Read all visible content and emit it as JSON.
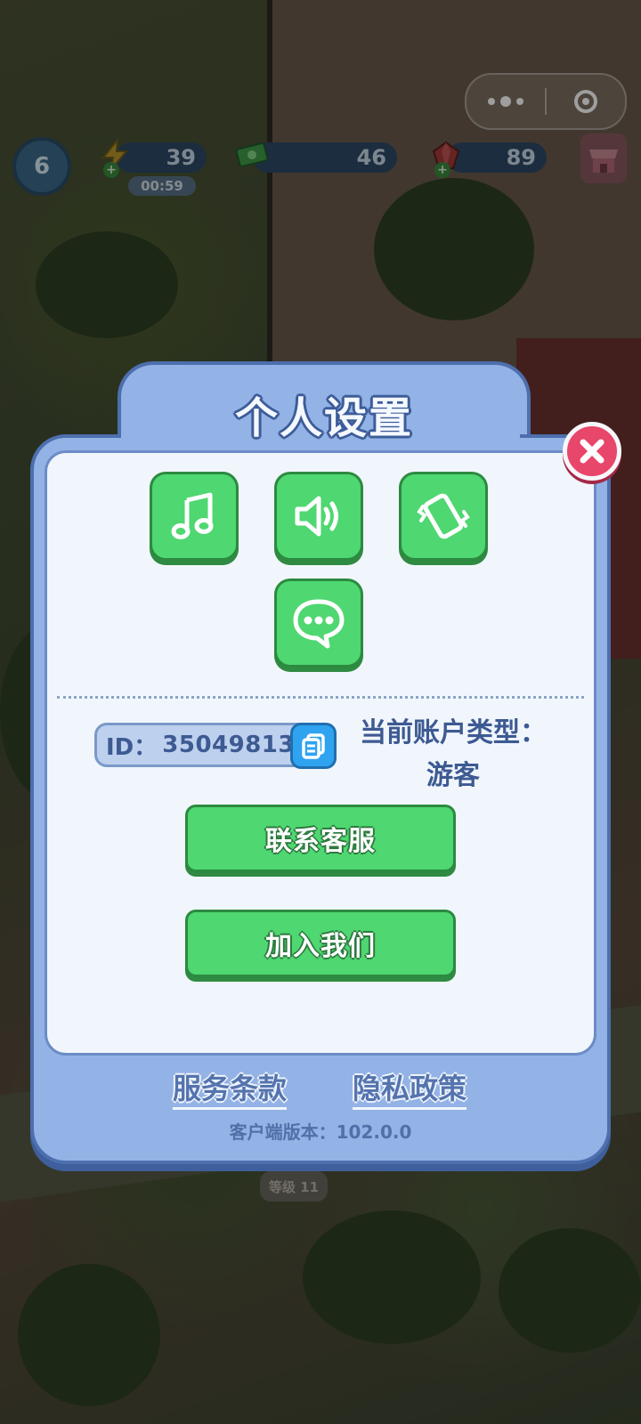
{
  "wechat_capsule": {
    "more_icon": "more-dots-icon",
    "close_icon": "target-close-icon"
  },
  "hud": {
    "level": "6",
    "energy": {
      "value": "39",
      "timer": "00:59",
      "icon": "lightning-icon"
    },
    "cash": {
      "value": "46",
      "icon": "cash-icon"
    },
    "gems": {
      "value": "89",
      "icon": "gem-icon"
    },
    "shop_icon": "shop-icon"
  },
  "background": {
    "level_tag": "等级 11"
  },
  "dialog": {
    "title": "个人设置",
    "close_icon": "close-icon",
    "toggles": [
      {
        "name": "music",
        "icon": "music-note-icon"
      },
      {
        "name": "sound",
        "icon": "speaker-icon"
      },
      {
        "name": "vibration",
        "icon": "vibrate-phone-icon"
      },
      {
        "name": "chat",
        "icon": "chat-bubble-icon"
      }
    ],
    "id_label": "ID：",
    "id_value": "350498130",
    "copy_icon": "copy-icon",
    "account_type_label": "当前账户类型：",
    "account_type_value": "游客",
    "contact_button": "联系客服",
    "join_button": "加入我们",
    "terms_link": "服务条款",
    "privacy_link": "隐私政策",
    "version_label": "客户端版本：",
    "version_value": "102.0.0"
  },
  "colors": {
    "panel": "#93b3e6",
    "panel_border": "#4d6fae",
    "inner": "#f1f6fd",
    "green": "#4fd771",
    "close_red": "#e8466a",
    "text_blue": "#3d5a92"
  }
}
